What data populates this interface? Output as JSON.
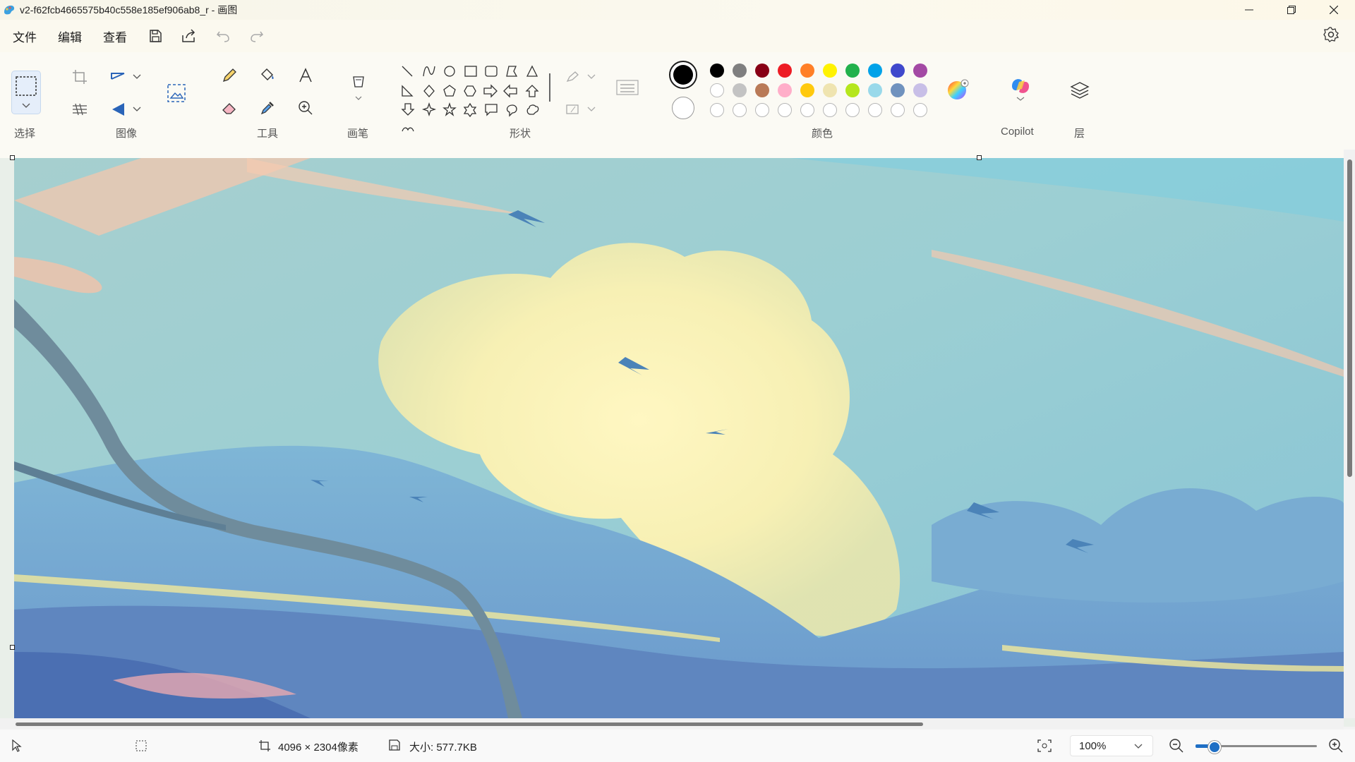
{
  "window": {
    "title": "v2-f62fcb4665575b40c558e185ef906ab8_r - 画图"
  },
  "menu": {
    "file": "文件",
    "edit": "编辑",
    "view": "查看"
  },
  "ribbon": {
    "groups": {
      "select": "选择",
      "image": "图像",
      "tools": "工具",
      "brushes": "画笔",
      "shapes": "形状",
      "colors": "颜色",
      "copilot": "Copilot",
      "layers": "层"
    },
    "color_row1": [
      "#000000",
      "#7f7f7f",
      "#880015",
      "#ed1c24",
      "#ff7f27",
      "#fff200",
      "#22b14c",
      "#00a2e8",
      "#3f48cc",
      "#a349a4"
    ],
    "color_row2": [
      "#ffffff",
      "#c3c3c3",
      "#b97a57",
      "#ffaec9",
      "#ffc90e",
      "#efe4b0",
      "#b5e61d",
      "#99d9ea",
      "#7092be",
      "#c8bfe7"
    ],
    "primary_color": "#000000",
    "secondary_color": "#ffffff"
  },
  "status": {
    "dimensions": "4096 × 2304像素",
    "size": "大小: 577.7KB",
    "zoom": "100%"
  }
}
